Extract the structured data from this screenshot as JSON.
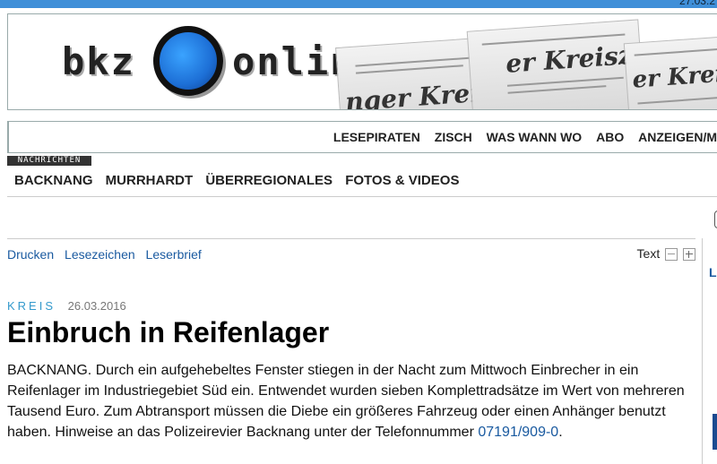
{
  "topbar": {
    "date_fragment": "27.03.2"
  },
  "banner": {
    "logo_left": "bkz",
    "logo_right": "online",
    "paper_texts": [
      "nger Kreis",
      "er Kreisz",
      "er Kreiz"
    ]
  },
  "nav_top": {
    "items": [
      "LESEPIRATEN",
      "ZISCH",
      "WAS WANN WO",
      "ABO",
      "ANZEIGEN/M"
    ]
  },
  "nav_tab": "NACHRICHTEN",
  "nav_main": {
    "items": [
      "BACKNANG",
      "MURRHARDT",
      "ÜBERREGIONALES",
      "FOTOS & VIDEOS"
    ]
  },
  "toolbar": {
    "print": "Drucken",
    "bookmark": "Lesezeichen",
    "letter": "Leserbrief",
    "text_label": "Text"
  },
  "sidebar": {
    "letter": "L"
  },
  "article": {
    "category": "KREIS",
    "date": "26.03.2016",
    "title": "Einbruch in Reifenlager",
    "body": "BACKNANG. Durch ein aufgehebeltes Fenster stiegen in der Nacht zum Mittwoch Einbrecher in ein Reifenlager im Industriegebiet Süd ein. Entwendet wurden sieben Komplettradsätze im Wert von mehreren Tausend Euro. Zum Abtransport müssen die Diebe ein größeres Fahrzeug oder einen Anhänger benutzt haben. Hinweise an das Polizeirevier Backnang unter der Telefonnummer ",
    "phone": "07191/909-0",
    "body_end": "."
  }
}
